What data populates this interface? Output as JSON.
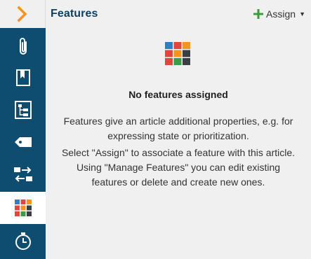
{
  "header": {
    "title": "Features",
    "assign_label": "Assign"
  },
  "sidebar": {
    "items": [
      {
        "name": "expand",
        "icon": "chevron-right-icon"
      },
      {
        "name": "attachments",
        "icon": "paperclip-icon"
      },
      {
        "name": "bookmarks",
        "icon": "bookmark-icon"
      },
      {
        "name": "structure",
        "icon": "tree-structure-icon"
      },
      {
        "name": "tags",
        "icon": "tag-icon"
      },
      {
        "name": "transfer",
        "icon": "transfer-icon"
      },
      {
        "name": "features",
        "icon": "features-grid-icon",
        "active": true
      },
      {
        "name": "history",
        "icon": "history-clock-icon"
      }
    ]
  },
  "main": {
    "empty_title": "No features assigned",
    "description_lines": [
      "Features give an article additional properties, e.g. for",
      "expressing state or prioritization."
    ],
    "instruction_lines": [
      "Select \"Assign\" to associate a feature with this article.",
      "Using \"Manage Features\" you can edit existing",
      "features or delete and create new ones."
    ]
  },
  "colors": {
    "sidebar_bg": "#0e4d6f",
    "accent_orange": "#f7941d",
    "add_green": "#3a9b3a",
    "feature_blue": "#2e7fc1",
    "feature_red": "#e0463e",
    "feature_orange": "#f7941d",
    "feature_green": "#3d9a48",
    "feature_dark": "#3a3f45"
  }
}
